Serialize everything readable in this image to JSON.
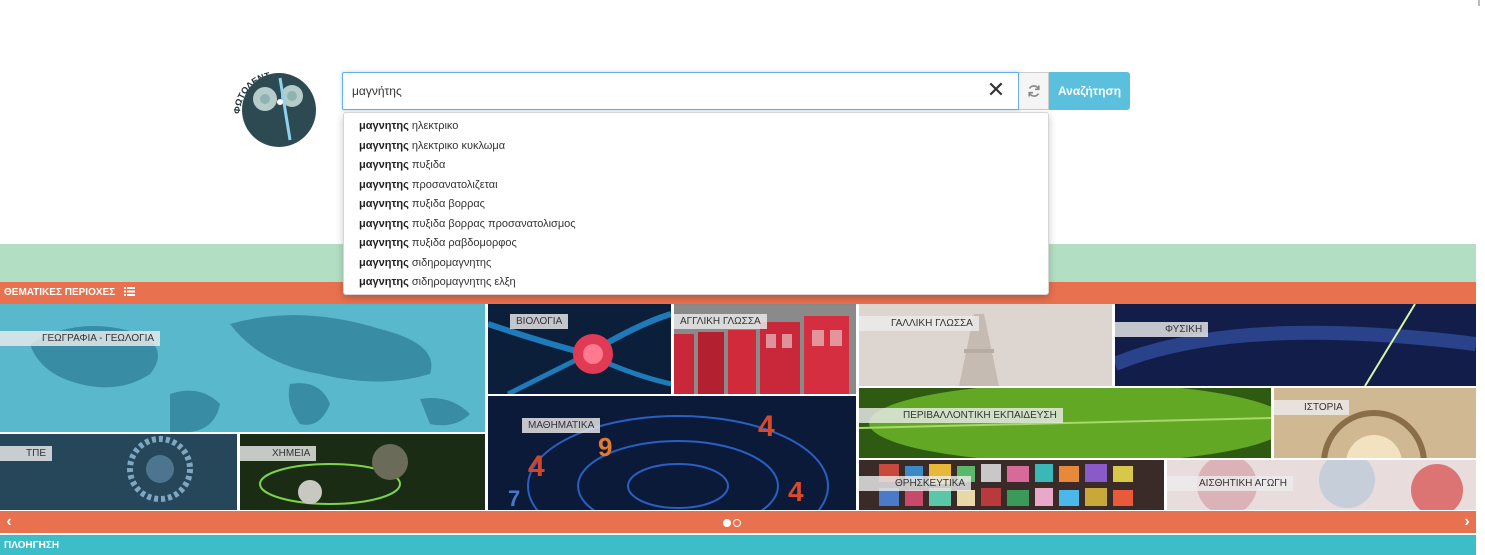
{
  "brand": {
    "logo_text": "ΦΩΤΟΔΕΝΤΡΟ"
  },
  "search": {
    "value": "μαγνήτης",
    "clear_label": "✕",
    "button_label": "Αναζήτηση"
  },
  "autocomplete": {
    "bold_prefix": "μαγνητης",
    "suggestions": [
      " ηλεκτρικο",
      " ηλεκτρικο κυκλωμα",
      " πυξιδα",
      " προσανατολιζεται",
      " πυξιδα βορρας",
      " πυξιδα βορρας προσανατολισμος",
      " πυξιδα ραβδομορφος",
      " σιδηρομαγνητης",
      " σιδηρομαγνητης ελξη"
    ]
  },
  "themes": {
    "header": "ΘΕΜΑΤΙΚΕΣ ΠΕΡΙΟΧΕΣ",
    "tiles": [
      "ΓΕΩΓΡΑΦΙΑ - ΓΕΩΛΟΓΙΑ",
      "ΒΙΟΛΟΓΙΑ",
      "ΑΓΓΛΙΚΗ ΓΛΩΣΣΑ",
      "ΓΑΛΛΙΚΗ ΓΛΩΣΣΑ",
      "ΦΥΣΙΚΗ",
      "ΤΠΕ",
      "ΧΗΜΕΙΑ",
      "ΜΑΘΗΜΑΤΙΚΑ",
      "ΠΕΡΙΒΑΛΛΟΝΤΙΚΗ ΕΚΠΑΙΔΕΥΣΗ",
      "ΙΣΤΟΡΙΑ",
      "ΘΡΗΣΚΕΥΤΙΚΑ",
      "ΑΙΣΘΗΤΙΚΗ ΑΓΩΓΗ"
    ]
  },
  "pager": {
    "prev": "‹",
    "next": "›",
    "current_page": 1,
    "total_pages": 2
  },
  "nav": {
    "label": "ΠΛΟΗΓΗΣΗ"
  },
  "colors": {
    "accent_orange": "#e8714f",
    "accent_teal": "#3dbdc8",
    "search_blue": "#5bc0de",
    "band_green": "#b2dfc3"
  }
}
